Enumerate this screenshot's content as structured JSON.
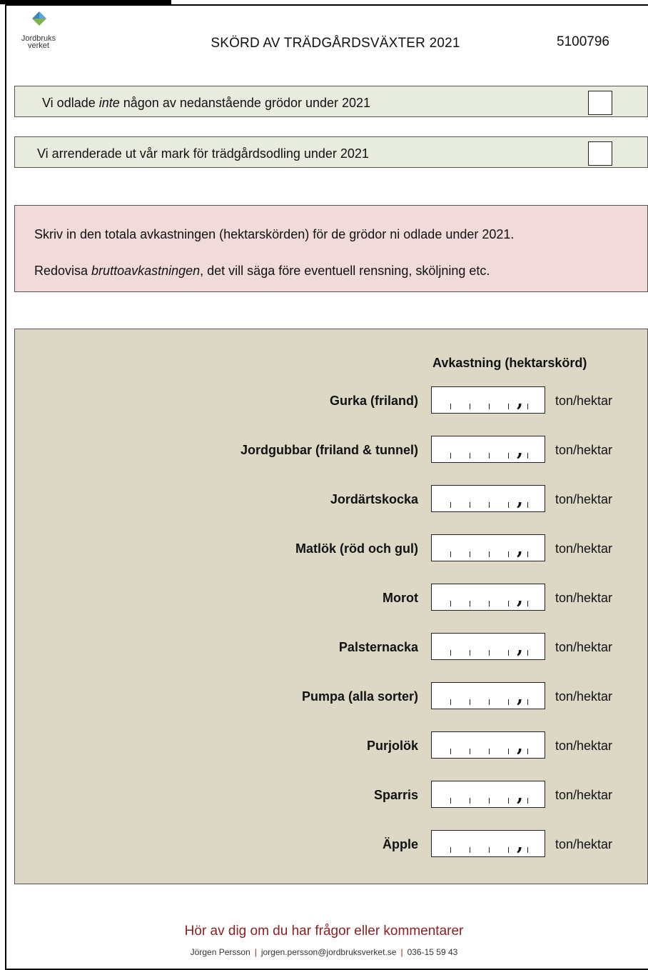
{
  "header": {
    "logo_line1": "Jordbruks",
    "logo_line2": "verket",
    "title": "SKÖRD AV TRÄDGÅRDSVÄXTER 2021",
    "form_id": "5100796"
  },
  "checks": {
    "row1_pre": "Vi odlade ",
    "row1_em": "inte",
    "row1_post": " någon av nedanstående grödor under 2021",
    "row2": "Vi arrenderade ut vår mark för trädgårdsodling under 2021"
  },
  "info": {
    "p1": "Skriv in den totala avkastningen (hektarskörden) för de grödor ni odlade under 2021.",
    "p2_pre": "Redovisa ",
    "p2_em": "bruttoavkastningen",
    "p2_post": ", det vill säga före eventuell rensning, sköljning etc."
  },
  "crops": {
    "column_header": "Avkastning (hektarskörd)",
    "unit": "ton/hektar",
    "decimal_separator": ",",
    "items": [
      "Gurka (friland)",
      "Jordgubbar (friland & tunnel)",
      "Jordärtskocka",
      "Matlök (röd och gul)",
      "Morot",
      "Palsternacka",
      "Pumpa (alla sorter)",
      "Purjolök",
      "Sparris",
      "Äpple"
    ]
  },
  "footer": {
    "title": "Hör av dig om du har frågor eller kommentarer",
    "name": "Jörgen Persson",
    "email": "jorgen.persson@jordbruksverket.se",
    "phone": "036-15 59 43"
  },
  "colors": {
    "check_bg": "#e8ecde",
    "info_bg": "#f1dada",
    "crops_bg": "#ddd8c6",
    "footer_accent": "#8b1f1f"
  }
}
